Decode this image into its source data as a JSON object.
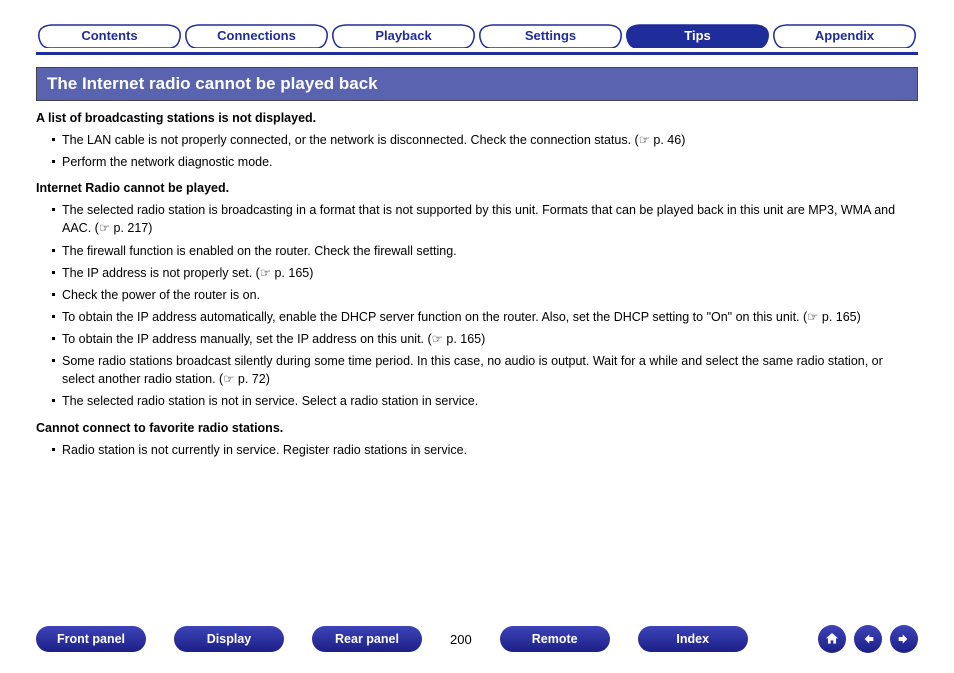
{
  "tabs": [
    {
      "label": "Contents",
      "active": false
    },
    {
      "label": "Connections",
      "active": false
    },
    {
      "label": "Playback",
      "active": false
    },
    {
      "label": "Settings",
      "active": false
    },
    {
      "label": "Tips",
      "active": true
    },
    {
      "label": "Appendix",
      "active": false
    }
  ],
  "banner": "The Internet radio cannot be played back",
  "sections": [
    {
      "heading": "A list of broadcasting stations is not displayed.",
      "items": [
        "The LAN cable is not properly connected, or the network is disconnected. Check the connection status.  (☞ p. 46)",
        "Perform the network diagnostic mode."
      ]
    },
    {
      "heading": "Internet Radio cannot be played.",
      "items": [
        "The selected radio station is broadcasting in a format that is not supported by this unit. Formats that can be played back in this unit are MP3, WMA and AAC.  (☞ p. 217)",
        "The firewall function is enabled on the router. Check the firewall setting.",
        "The IP address is not properly set.  (☞ p. 165)",
        "Check the power of the router is on.",
        "To obtain the IP address automatically, enable the DHCP server function on the router. Also, set the DHCP setting to \"On\" on this unit.  (☞ p. 165)",
        "To obtain the IP address manually, set the IP address on this unit.  (☞ p. 165)",
        "Some radio stations broadcast silently during some time period. In this case, no audio is output. Wait for a while and select the same radio station, or select another radio station.  (☞ p. 72)",
        "The selected radio station is not in service. Select a radio station in service."
      ]
    },
    {
      "heading": "Cannot connect to favorite radio stations.",
      "items": [
        "Radio station is not currently in service. Register radio stations in service."
      ]
    }
  ],
  "footer": {
    "buttons_left": [
      "Front panel",
      "Display",
      "Rear panel"
    ],
    "page_number": "200",
    "buttons_right": [
      "Remote",
      "Index"
    ]
  }
}
